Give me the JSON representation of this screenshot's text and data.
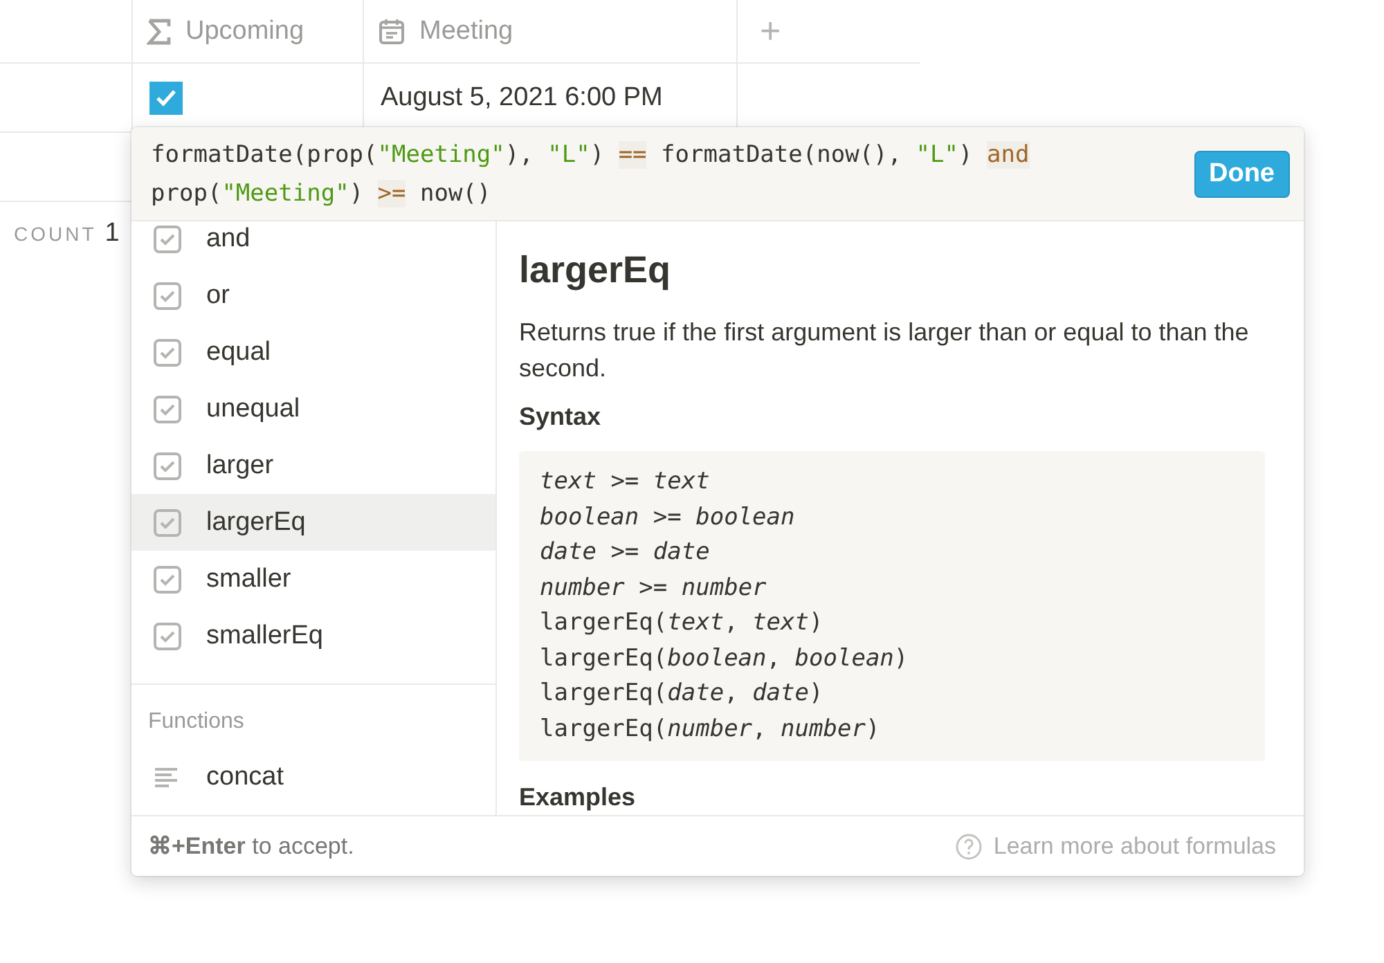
{
  "table": {
    "columns": [
      {
        "label": "Upcoming",
        "kind": "formula"
      },
      {
        "label": "Meeting",
        "kind": "date"
      }
    ],
    "rows": [
      {
        "upcoming_checked": true,
        "meeting": "August 5, 2021 6:00 PM"
      }
    ],
    "add_column": "+",
    "footer": {
      "label": "COUNT",
      "value": "1"
    }
  },
  "formula_editor": {
    "lines": [
      [
        {
          "text": "formatDate(prop(",
          "kind": "plain"
        },
        {
          "text": "\"Meeting\"",
          "kind": "string"
        },
        {
          "text": "), ",
          "kind": "plain"
        },
        {
          "text": "\"L\"",
          "kind": "string"
        },
        {
          "text": ") ",
          "kind": "plain"
        },
        {
          "text": "==",
          "kind": "operator"
        },
        {
          "text": " formatDate(now(), ",
          "kind": "plain"
        },
        {
          "text": "\"L\"",
          "kind": "string"
        },
        {
          "text": ") ",
          "kind": "plain"
        },
        {
          "text": "and",
          "kind": "operator"
        }
      ],
      [
        {
          "text": "prop(",
          "kind": "plain"
        },
        {
          "text": "\"Meeting\"",
          "kind": "string"
        },
        {
          "text": ") ",
          "kind": "plain"
        },
        {
          "text": ">=",
          "kind": "operator"
        },
        {
          "text": " now()",
          "kind": "plain"
        }
      ]
    ],
    "done_button": "Done",
    "sections": [
      {
        "items": [
          {
            "label": "and",
            "kind": "boolean",
            "selected": false
          },
          {
            "label": "or",
            "kind": "boolean",
            "selected": false
          },
          {
            "label": "equal",
            "kind": "boolean",
            "selected": false
          },
          {
            "label": "unequal",
            "kind": "boolean",
            "selected": false
          },
          {
            "label": "larger",
            "kind": "boolean",
            "selected": false
          },
          {
            "label": "largerEq",
            "kind": "boolean",
            "selected": true
          },
          {
            "label": "smaller",
            "kind": "boolean",
            "selected": false
          },
          {
            "label": "smallerEq",
            "kind": "boolean",
            "selected": false
          }
        ]
      },
      {
        "heading": "Functions",
        "items": [
          {
            "label": "concat",
            "kind": "text",
            "selected": false
          }
        ]
      }
    ],
    "docs": {
      "title": "largerEq",
      "description": "Returns true if the first argument is larger than or equal to than the second.",
      "syntax_heading": "Syntax",
      "syntax": [
        "*text* >= *text*",
        "*boolean* >= *boolean*",
        "*date* >= *date*",
        "*number* >= *number*",
        "largerEq(*text*, *text*)",
        "largerEq(*boolean*, *boolean*)",
        "largerEq(*date*, *date*)",
        "largerEq(*number*, *number*)"
      ],
      "examples_heading": "Examples"
    },
    "hint": "**⌘+Enter** to accept.",
    "help_link": "Learn more about formulas"
  }
}
